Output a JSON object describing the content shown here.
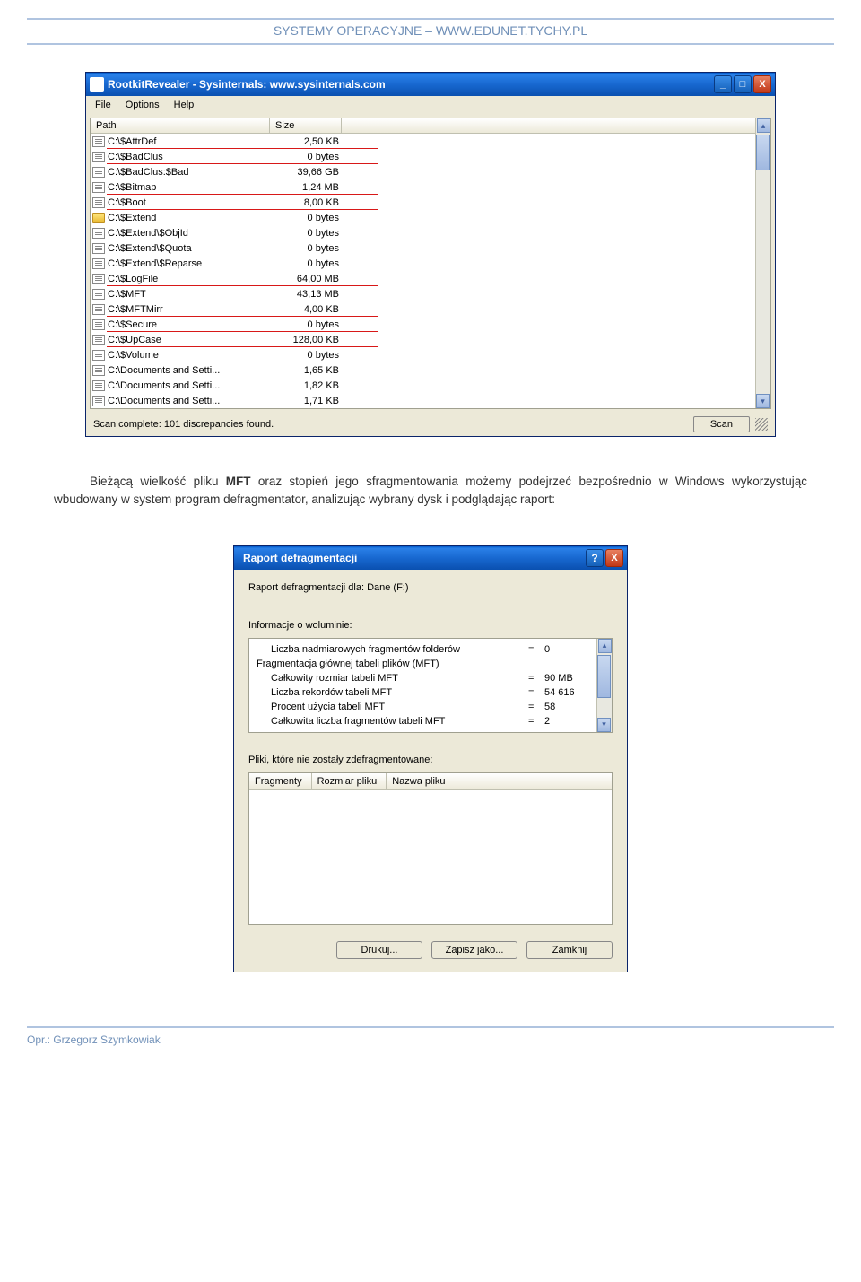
{
  "header": "SYSTEMY OPERACYJNE – WWW.EDUNET.TYCHY.PL",
  "win1": {
    "title": "RootkitRevealer - Sysinternals: www.sysinternals.com",
    "menu": {
      "file": "File",
      "options": "Options",
      "help": "Help"
    },
    "cols": {
      "path": "Path",
      "size": "Size"
    },
    "rows": [
      {
        "icon": "file",
        "path": "C:\\$AttrDef",
        "size": "2,50 KB",
        "red": true
      },
      {
        "icon": "file",
        "path": "C:\\$BadClus",
        "size": "0 bytes",
        "red": true
      },
      {
        "icon": "file",
        "path": "C:\\$BadClus:$Bad",
        "size": "39,66 GB",
        "red": false
      },
      {
        "icon": "file",
        "path": "C:\\$Bitmap",
        "size": "1,24 MB",
        "red": true
      },
      {
        "icon": "file",
        "path": "C:\\$Boot",
        "size": "8,00 KB",
        "red": true
      },
      {
        "icon": "folder",
        "path": "C:\\$Extend",
        "size": "0 bytes",
        "red": false
      },
      {
        "icon": "file",
        "path": "C:\\$Extend\\$ObjId",
        "size": "0 bytes",
        "red": false
      },
      {
        "icon": "file",
        "path": "C:\\$Extend\\$Quota",
        "size": "0 bytes",
        "red": false
      },
      {
        "icon": "file",
        "path": "C:\\$Extend\\$Reparse",
        "size": "0 bytes",
        "red": false
      },
      {
        "icon": "file",
        "path": "C:\\$LogFile",
        "size": "64,00 MB",
        "red": true
      },
      {
        "icon": "file",
        "path": "C:\\$MFT",
        "size": "43,13 MB",
        "red": true
      },
      {
        "icon": "file",
        "path": "C:\\$MFTMirr",
        "size": "4,00 KB",
        "red": true
      },
      {
        "icon": "file",
        "path": "C:\\$Secure",
        "size": "0 bytes",
        "red": true
      },
      {
        "icon": "file",
        "path": "C:\\$UpCase",
        "size": "128,00 KB",
        "red": true
      },
      {
        "icon": "file",
        "path": "C:\\$Volume",
        "size": "0 bytes",
        "red": true
      },
      {
        "icon": "file",
        "path": "C:\\Documents and Setti...",
        "size": "1,65 KB",
        "red": false
      },
      {
        "icon": "file",
        "path": "C:\\Documents and Setti...",
        "size": "1,82 KB",
        "red": false
      },
      {
        "icon": "file",
        "path": "C:\\Documents and Setti...",
        "size": "1,71 KB",
        "red": false
      }
    ],
    "status": "Scan complete: 101 discrepancies found.",
    "scan_btn": "Scan"
  },
  "body_text_1": "Bieżącą wielkość pliku ",
  "body_text_bold": "MFT",
  "body_text_2": " oraz stopień jego sfragmentowania możemy podejrzeć bezpośrednio w Windows wykorzystując wbudowany w system program defragmentator, analizując wybrany dysk i podglądając raport:",
  "win2": {
    "title": "Raport defragmentacji",
    "report_for": "Raport defragmentacji dla:  Dane (F:)",
    "vol_info": "Informacje o woluminie:",
    "rows": [
      {
        "lbl": "Liczba nadmiarowych fragmentów folderów",
        "sub": true,
        "val": "0"
      },
      {
        "lbl": "Fragmentacja głównej tabeli plików (MFT)",
        "sub": false,
        "val": ""
      },
      {
        "lbl": "Całkowity rozmiar tabeli MFT",
        "sub": true,
        "val": "90 MB"
      },
      {
        "lbl": "Liczba rekordów tabeli MFT",
        "sub": true,
        "val": "54 616"
      },
      {
        "lbl": "Procent użycia tabeli MFT",
        "sub": true,
        "val": "58"
      },
      {
        "lbl": "Całkowita liczba fragmentów tabeli MFT",
        "sub": true,
        "val": "2"
      }
    ],
    "frag_label": "Pliki, które nie zostały zdefragmentowane:",
    "frag_cols": {
      "c1": "Fragmenty",
      "c2": "Rozmiar pliku",
      "c3": "Nazwa pliku"
    },
    "btns": {
      "print": "Drukuj...",
      "saveas": "Zapisz jako...",
      "close": "Zamknij"
    }
  },
  "footer": "Opr.: Grzegorz Szymkowiak"
}
